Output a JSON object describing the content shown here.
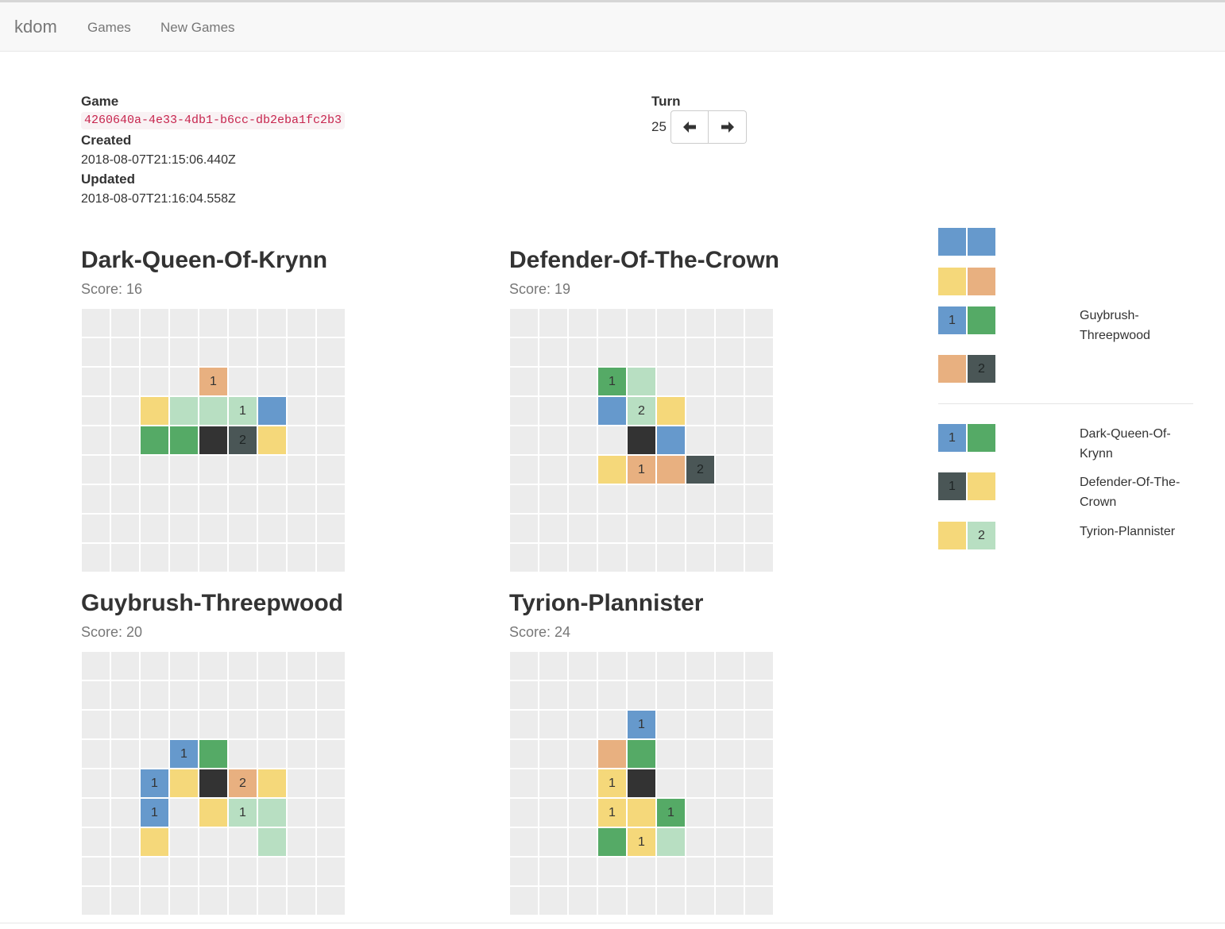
{
  "nav": {
    "brand": "kdom",
    "links": [
      "Games",
      "New Games"
    ]
  },
  "meta": {
    "game_label": "Game",
    "game_id": "4260640a-4e33-4db1-b6cc-db2eba1fc2b3",
    "created_label": "Created",
    "created": "2018-08-07T21:15:06.440Z",
    "updated_label": "Updated",
    "updated": "2018-08-07T21:16:04.558Z"
  },
  "turn": {
    "label": "Turn",
    "value": "25"
  },
  "colors": {
    "E": "#ececec",
    "W": "#6699cc",
    "G": "#55aa66",
    "Y": "#f5d87a",
    "O": "#e8b080",
    "L": "#b8dfc2",
    "K": "#333333",
    "S": "#4a5656"
  },
  "players": [
    {
      "name": "Dark-Queen-Of-Krynn",
      "score": "Score: 16",
      "board": [
        "E,E,E,E,E,E,E,E,E",
        "E,E,E,E,E,E,E,E,E",
        "E,E,E,E,O1,E,E,E,E",
        "E,E,Y,L,L,L1,W,E,E",
        "E,E,G,G,K,S2,Y,E,E",
        "E,E,E,E,E,E,E,E,E",
        "E,E,E,E,E,E,E,E,E",
        "E,E,E,E,E,E,E,E,E",
        "E,E,E,E,E,E,E,E,E"
      ]
    },
    {
      "name": "Defender-Of-The-Crown",
      "score": "Score: 19",
      "board": [
        "E,E,E,E,E,E,E,E,E",
        "E,E,E,E,E,E,E,E,E",
        "E,E,E,G1,L,E,E,E,E",
        "E,E,E,W,L2,Y,E,E,E",
        "E,E,E,E,K,W,E,E,E",
        "E,E,E,Y,O1,O,S2,E,E",
        "E,E,E,E,E,E,E,E,E",
        "E,E,E,E,E,E,E,E,E",
        "E,E,E,E,E,E,E,E,E"
      ]
    },
    {
      "name": "Guybrush-Threepwood",
      "score": "Score: 20",
      "board": [
        "E,E,E,E,E,E,E,E,E",
        "E,E,E,E,E,E,E,E,E",
        "E,E,E,E,E,E,E,E,E",
        "E,E,E,W1,G,E,E,E,E",
        "E,E,W1,Y,K,O2,Y,E,E",
        "E,E,W1,E,Y,L1,L,E,E",
        "E,E,Y,E,E,E,L,E,E",
        "E,E,E,E,E,E,E,E,E",
        "E,E,E,E,E,E,E,E,E"
      ]
    },
    {
      "name": "Tyrion-Plannister",
      "score": "Score: 24",
      "board": [
        "E,E,E,E,E,E,E,E,E",
        "E,E,E,E,E,E,E,E,E",
        "E,E,E,E,W1,E,E,E,E",
        "E,E,E,O,G,E,E,E,E",
        "E,E,E,Y1,K,E,E,E,E",
        "E,E,E,Y1,Y,G1,E,E,E",
        "E,E,E,G,Y1,L,E,E,E",
        "E,E,E,E,E,E,E,E,E",
        "E,E,E,E,E,E,E,E,E"
      ]
    }
  ],
  "draft_upcoming": [
    {
      "tiles": [
        "W",
        "W"
      ],
      "player": ""
    },
    {
      "tiles": [
        "Y",
        "O"
      ],
      "player": ""
    },
    {
      "tiles": [
        "W1",
        "G"
      ],
      "player": "Guybrush-Threepwood"
    },
    {
      "tiles": [
        "O",
        "S2"
      ],
      "player": ""
    }
  ],
  "draft_current": [
    {
      "tiles": [
        "W1",
        "G"
      ],
      "player": "Dark-Queen-Of-Krynn"
    },
    {
      "tiles": [
        "S1",
        "Y"
      ],
      "player": "Defender-Of-The-Crown"
    },
    {
      "tiles": [
        "Y",
        "L2"
      ],
      "player": "Tyrion-Plannister"
    }
  ]
}
